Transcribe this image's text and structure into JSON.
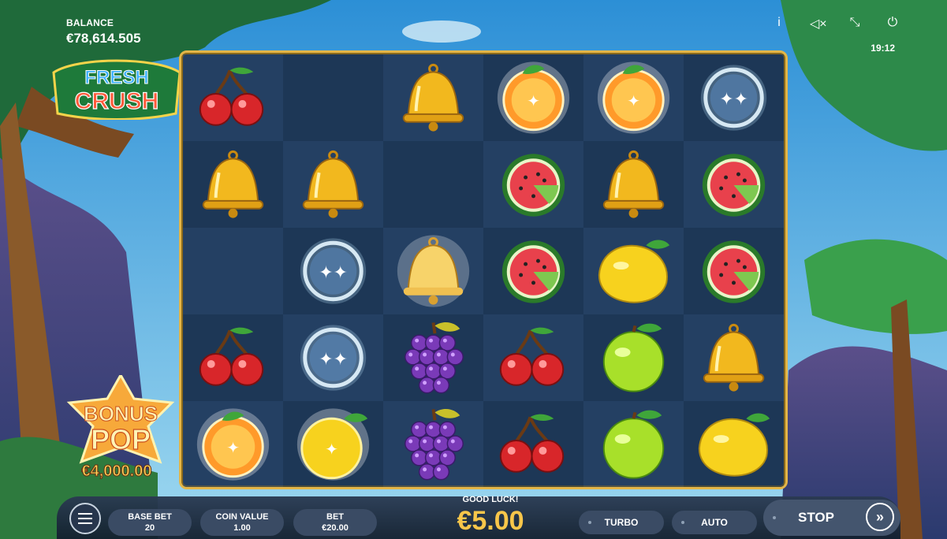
{
  "balance": {
    "label": "BALANCE",
    "value": "€78,614.505"
  },
  "top_icons": {
    "info": "i",
    "mute": "◁×",
    "fullscreen": "⤡",
    "power": "⏻"
  },
  "clock": "19:12",
  "logo": {
    "line1": "FRESH",
    "line2": "CRUSH"
  },
  "bonus": {
    "line1": "BONUS",
    "line2": "POP",
    "amount": "€4,000.00"
  },
  "grid": {
    "rows": [
      [
        "cherry",
        "empty",
        "bell",
        "orange-glow",
        "orange-glow",
        "sparkle-ring"
      ],
      [
        "bell",
        "bell",
        "empty",
        "watermelon",
        "bell",
        "watermelon"
      ],
      [
        "empty",
        "sparkle-ring",
        "bell-glow",
        "watermelon",
        "lemon",
        "watermelon"
      ],
      [
        "cherry",
        "sparkle-ring",
        "grapes",
        "cherry",
        "green-apple",
        "bell"
      ],
      [
        "orange-glow",
        "lemon-glow",
        "grapes",
        "cherry",
        "green-apple",
        "lemon"
      ]
    ]
  },
  "bottom": {
    "base_bet": {
      "label": "BASE BET",
      "value": "20"
    },
    "coin_value": {
      "label": "COIN VALUE",
      "value": "1.00"
    },
    "bet": {
      "label": "BET",
      "value": "€20.00"
    },
    "status": "GOOD LUCK!",
    "win": "€5.00",
    "turbo": "TURBO",
    "auto": "AUTO",
    "stop": "STOP",
    "spin_icon": "»"
  },
  "colors": {
    "frame": "#e4b648",
    "win": "#f7c64a"
  }
}
